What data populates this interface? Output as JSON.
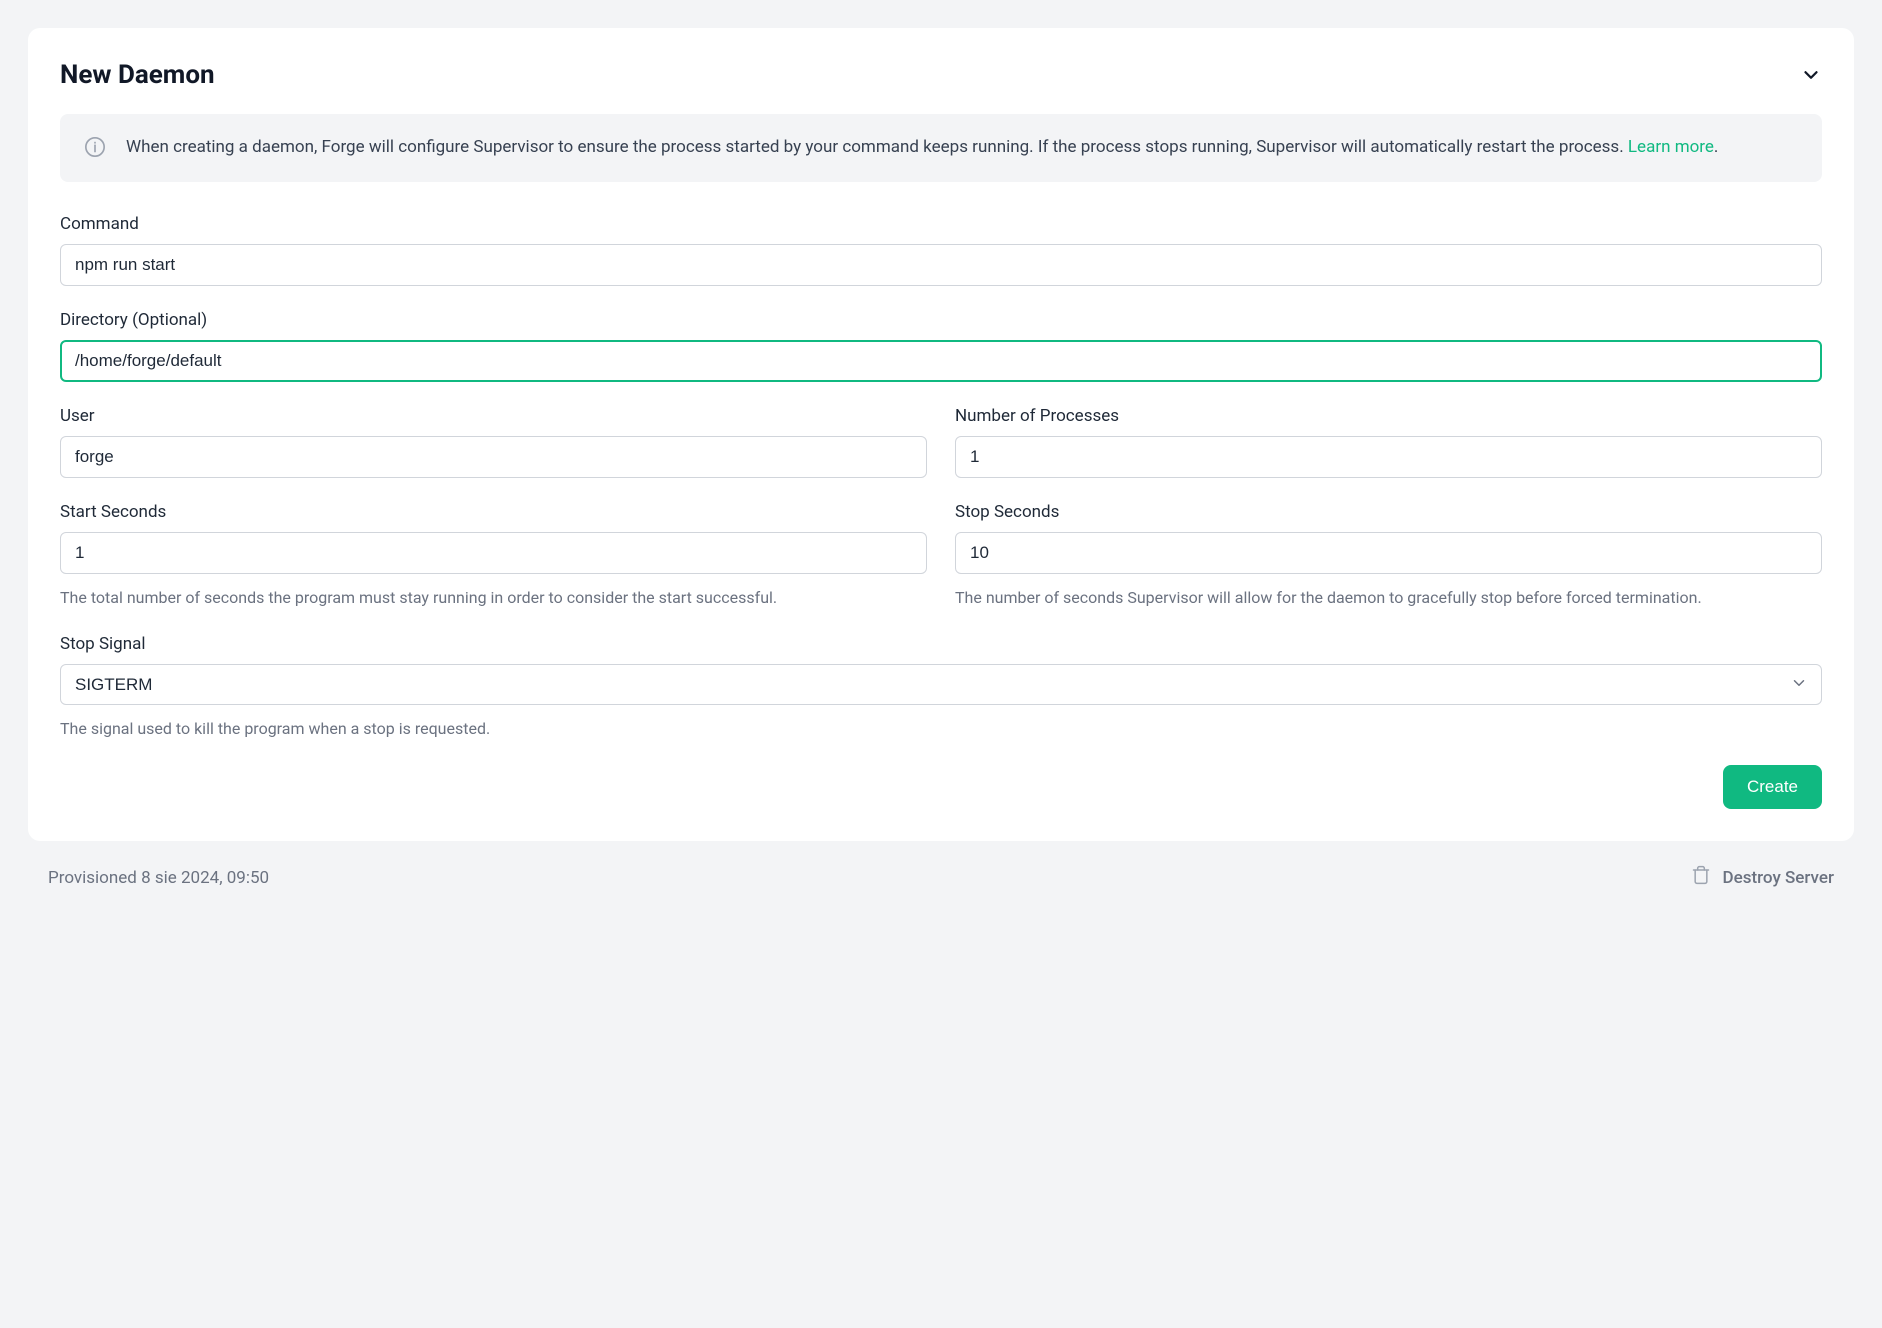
{
  "header": {
    "title": "New Daemon"
  },
  "info": {
    "text": "When creating a daemon, Forge will configure Supervisor to ensure the process started by your command keeps running. If the process stops running, Supervisor will automatically restart the process.",
    "link_text": "Learn more",
    "period": "."
  },
  "form": {
    "command": {
      "label": "Command",
      "value": "npm run start"
    },
    "directory": {
      "label": "Directory (Optional)",
      "value": "/home/forge/default"
    },
    "user": {
      "label": "User",
      "value": "forge"
    },
    "processes": {
      "label": "Number of Processes",
      "value": "1"
    },
    "start_seconds": {
      "label": "Start Seconds",
      "value": "1",
      "help": "The total number of seconds the program must stay running in order to consider the start successful."
    },
    "stop_seconds": {
      "label": "Stop Seconds",
      "value": "10",
      "help": "The number of seconds Supervisor will allow for the daemon to gracefully stop before forced termination."
    },
    "stop_signal": {
      "label": "Stop Signal",
      "value": "SIGTERM",
      "help": "The signal used to kill the program when a stop is requested."
    }
  },
  "buttons": {
    "create": "Create"
  },
  "footer": {
    "provisioned": "Provisioned 8 sie 2024, 09:50",
    "destroy": "Destroy Server"
  }
}
